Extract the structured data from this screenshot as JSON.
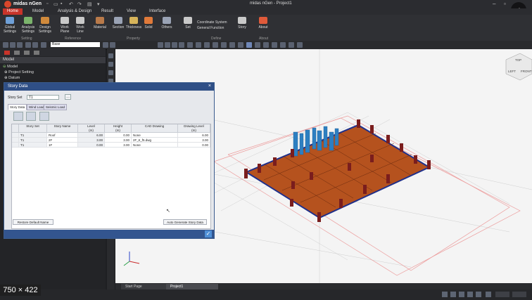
{
  "app": {
    "name": "midas nGen",
    "window_title": "midas nGen - Project1"
  },
  "menu_tabs": [
    "Home",
    "Model",
    "Analysis & Design",
    "Result",
    "View",
    "Interface"
  ],
  "ribbon": {
    "buttons": [
      {
        "label": "Global\nSettings",
        "color": "#6fa0d8"
      },
      {
        "label": "Analysis\nSettings",
        "color": "#7bb46c"
      },
      {
        "label": "Design\nSettings",
        "color": "#d08a3c"
      },
      {
        "label": "Work\nPlane",
        "color": "#c9c9c9"
      },
      {
        "label": "Work\nLine",
        "color": "#c9c9c9"
      },
      {
        "label": "Material",
        "color": "#b97a4a"
      },
      {
        "label": "Section",
        "color": "#9aa3b5"
      },
      {
        "label": "Thickness",
        "color": "#d7b45a"
      },
      {
        "label": "Solid",
        "color": "#e07a3a"
      },
      {
        "label": "Others",
        "color": "#9aa3b5"
      },
      {
        "label": "Set",
        "color": "#c9c9c9"
      },
      {
        "label": "Story",
        "color": "#c9c9c9"
      },
      {
        "label": "About",
        "color": "#e05a3a"
      }
    ],
    "coordinate_system": "Coordinate System",
    "general_function": "General Function",
    "groups": [
      "Setting",
      "Reference",
      "Property",
      "Define",
      "About"
    ]
  },
  "toolbar": {
    "story_selector": "Base"
  },
  "left_panel": {
    "header": "Model",
    "tree": [
      "Model",
      "Project Setting",
      "Datum"
    ]
  },
  "dialog": {
    "title": "Story Data",
    "story_set_label": "Story Set",
    "story_set_value": "T1",
    "tabs": [
      "Story Data",
      "Wind Load",
      "Seismic Load"
    ],
    "columns": [
      "",
      "Story Set",
      "Story Name",
      "Level\n(m)",
      "Height\n(m)",
      "CAD Drawing",
      "Drawing Level\n(m)"
    ],
    "rows": [
      {
        "set": "T1",
        "name": "Roof",
        "level": "6.00",
        "height": "0.00",
        "cad": "None",
        "draw_level": "6.00"
      },
      {
        "set": "T1",
        "name": "2F",
        "level": "3.00",
        "height": "3.00",
        "cad": "2F_€_f5.dwg",
        "draw_level": "3.00"
      },
      {
        "set": "T1",
        "name": "1F",
        "level": "0.00",
        "height": "3.00",
        "cad": "None",
        "draw_level": "0.00"
      }
    ],
    "restore_button": "Restore Default Name",
    "auto_button": "Auto Generate Story Data"
  },
  "viewcube": {
    "top": "TOP",
    "left": "LEFT",
    "front": "FRONT"
  },
  "doc_tabs": [
    "Start Page",
    "Project1"
  ],
  "overlay_size_label": "750 × 422",
  "colors": {
    "accent": "#c8342a",
    "slab": "#b5521e",
    "column": "#7a1d1d",
    "core_walls": "#2e7fc1"
  }
}
